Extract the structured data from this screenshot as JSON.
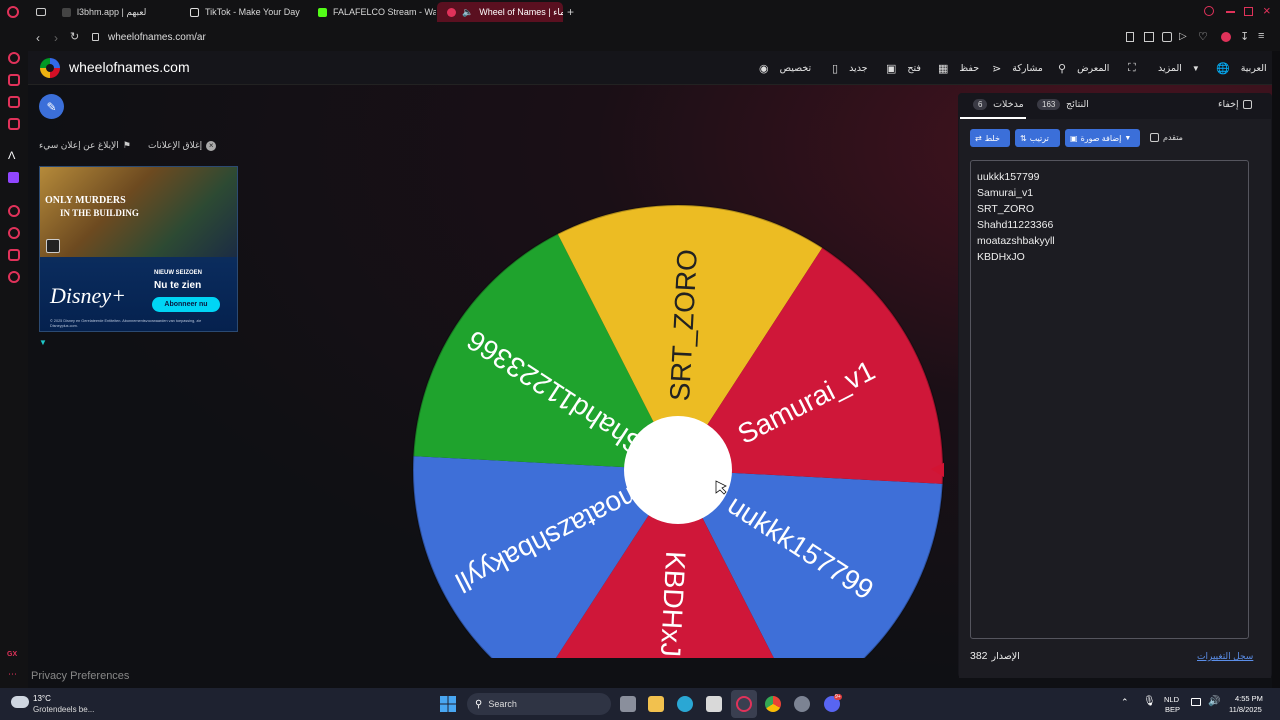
{
  "tabs": [
    {
      "label": "l3bhm.app | لعبهم"
    },
    {
      "label": "TikTok - Make Your Day"
    },
    {
      "label": "FALAFELCO Stream - Wa"
    },
    {
      "label": "Wheel of Names | عجلة الأسماء"
    }
  ],
  "address": {
    "url": "wheelofnames.com/ar"
  },
  "site": {
    "brand": "wheelofnames.com",
    "nav": {
      "customize": "تخصيص",
      "new": "جديد",
      "open": "فتح",
      "save": "حفظ",
      "share": "مشاركة",
      "gallery": "المعرض",
      "more": "المزيد",
      "language": "العربية"
    }
  },
  "ads": {
    "report": "الإبلاغ عن إعلان سيء",
    "close": "إغلاق الإعلانات",
    "title_line1": "ONLY MURDERS",
    "title_line2": "IN THE BUILDING",
    "season": "NIEUW SEIZOEN",
    "watch": "Nu te zien",
    "brand": "Disney+",
    "cta": "Abonneer nu",
    "fine_print": "© 2025 Disney en Gerelateerde Entiteiten. Abonnementsvoorwaarden van toepassing, zie Disneyplus.com."
  },
  "wheel": {
    "segments": [
      {
        "label": "uukkk157799",
        "color": "#3e6fd8"
      },
      {
        "label": "KBDHxJO",
        "color": "#cf1739"
      },
      {
        "label": "moatazshbakyyll",
        "color": "#3e6fd8"
      },
      {
        "label": "Shahd11223366",
        "color": "#1fa32d"
      },
      {
        "label": "SRT_ZORO",
        "color": "#ecbc23"
      },
      {
        "label": "Samurai_v1",
        "color": "#cf1739"
      }
    ]
  },
  "panel": {
    "hide_label": "إخفاء",
    "results_label": "النتائج",
    "results_count": "163",
    "entries_label": "مدخلات",
    "entries_count": "6",
    "shuffle": "خلط",
    "sort": "ترتيب",
    "add_image": "إضافة صورة",
    "advanced": "متقدم",
    "entries": [
      "uukkk157799",
      "Samurai_v1",
      "SRT_ZORO",
      "Shahd11223366",
      "moatazshbakyyll",
      "KBDHxJO"
    ],
    "version_label": "الإصدار",
    "version": "382",
    "changelog": "سجل التغييرات"
  },
  "privacy": "Privacy Preferences",
  "taskbar": {
    "temp": "13°C",
    "weather": "Grotendeels be...",
    "search": "Search",
    "lang1": "NLD",
    "lang2": "BEP",
    "time": "4:55 PM",
    "date": "11/8/2025",
    "discord_badge": "9+"
  }
}
